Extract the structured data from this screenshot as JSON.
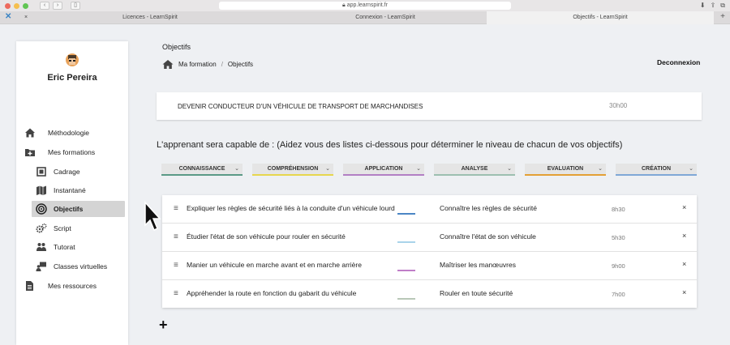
{
  "browser": {
    "url": "app.learnspirit.fr",
    "tabs": [
      {
        "title": "Licences - LearnSpirit"
      },
      {
        "title": "Connexion - LearnSpirit"
      },
      {
        "title": "Objectifs - LearnSpirit"
      }
    ]
  },
  "sidebar": {
    "user_name": "Eric Pereira",
    "items": [
      {
        "label": "Méthodologie",
        "icon": "home-icon"
      },
      {
        "label": "Mes formations",
        "icon": "folder-plus-icon"
      },
      {
        "label": "Cadrage",
        "icon": "frame-icon"
      },
      {
        "label": "Instantané",
        "icon": "map-icon"
      },
      {
        "label": "Objectifs",
        "icon": "target-icon"
      },
      {
        "label": "Script",
        "icon": "gears-icon"
      },
      {
        "label": "Tutorat",
        "icon": "users-icon"
      },
      {
        "label": "Classes virtuelles",
        "icon": "presentation-icon"
      },
      {
        "label": "Mes ressources",
        "icon": "document-icon"
      }
    ]
  },
  "header": {
    "title": "Objectifs",
    "breadcrumb": [
      "Ma formation",
      "Objectifs"
    ],
    "separator": "/",
    "logout_label": "Deconnexion"
  },
  "formation": {
    "name": "DEVENIR CONDUCTEUR D'UN VÉHICULE DE TRANSPORT DE MARCHANDISES",
    "duration": "30h00"
  },
  "instruction": "L'apprenant sera capable de :  (Aidez vous des listes ci-dessous pour déterminer le niveau de chacun de vos objectifs)",
  "categories": [
    {
      "label": "CONNAISSANCE",
      "color": "#5a9a86"
    },
    {
      "label": "COMPRÉHENSION",
      "color": "#e6d64e"
    },
    {
      "label": "APPLICATION",
      "color": "#b27fc4"
    },
    {
      "label": "ANALYSE",
      "color": "#9dbfb0"
    },
    {
      "label": "EVALUATION",
      "color": "#e3a035"
    },
    {
      "label": "CRÉATION",
      "color": "#7fa8d6"
    }
  ],
  "objectives": [
    {
      "text": "Expliquer les règles de sécurité liés à la conduite d'un véhicule lourd",
      "verb": "Connaître les règles de sécurité",
      "time": "8h30",
      "level_color": "#4b86c5"
    },
    {
      "text": "Étudier l'état de son véhicule pour rouler en sécurité",
      "verb": "Connaître l'état de son véhicule",
      "time": "5h30",
      "level_color": "#a9d4ea"
    },
    {
      "text": "Manier un véhicule en marche avant et en marche arrière",
      "verb": "Maîtriser les manœuvres",
      "time": "9h00",
      "level_color": "#c07ec8"
    },
    {
      "text": "Appréhender la route en fonction du gabarit du véhicule",
      "verb": "Rouler en toute sécurité",
      "time": "7h00",
      "level_color": "#b9c8b8"
    }
  ],
  "add_label": "+",
  "delete_label": "×"
}
